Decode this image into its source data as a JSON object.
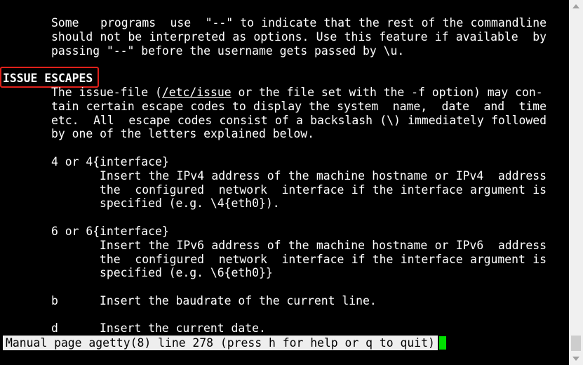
{
  "manpage": {
    "para1": [
      "Some   programs  use  \"--\" to indicate that the rest of the commandline",
      "should not be interpreted as options. Use this feature if available  by",
      "passing \"--\" before the username gets passed by \\u."
    ],
    "section_heading": "ISSUE ESCAPES",
    "issue_para": {
      "l1_a": "The issue-file (",
      "l1_link": "/etc/issue",
      "l1_b": " or the file set with the -f option) may con-",
      "l2": "tain certain escape codes to display the system  name,  date  and  time",
      "l3": "etc.  All  escape codes consist of a backslash (\\) immediately followed",
      "l4": "by one of the letters explained below."
    },
    "escapes": [
      {
        "term": "4 or 4{interface}",
        "desc": [
          "Insert the IPv4 address of the machine hostname or IPv4  address",
          "the  configured  network  interface if the interface argument is",
          "specified (e.g. \\4{eth0})."
        ]
      },
      {
        "term": "6 or 6{interface}",
        "desc": [
          "Insert the IPv6 address of the machine hostname or IPv6  address",
          "the  configured  network  interface if the interface argument is",
          "specified (e.g. \\6{eth0}}"
        ]
      },
      {
        "term": "b",
        "desc": [
          "Insert the baudrate of the current line."
        ]
      },
      {
        "term": "d",
        "desc": [
          "Insert the current date."
        ]
      }
    ]
  },
  "status_bar": {
    "text": "Manual page agetty(8) line 278 (press h for help or q to quit)"
  },
  "icons": {
    "scroll_up": "triangle-up-icon",
    "scroll_down": "triangle-down-icon"
  },
  "colors": {
    "background": "#000000",
    "text": "#ffffff",
    "highlight_box": "#e0201a",
    "cursor": "#00e000",
    "status_bg": "#eeeeee"
  }
}
